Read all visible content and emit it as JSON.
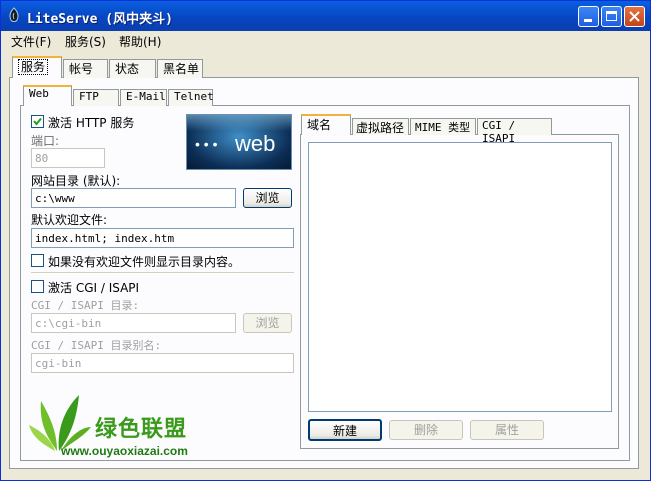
{
  "window": {
    "title": "LiteServe (风中夹斗)"
  },
  "menu": [
    {
      "label": "文件(F)"
    },
    {
      "label": "服务(S)"
    },
    {
      "label": "帮助(H)"
    }
  ],
  "top_tabs": [
    "服务",
    "帐号",
    "状态",
    "黑名单"
  ],
  "service_tabs": [
    "Web",
    "FTP",
    "E-Mail",
    "Telnet"
  ],
  "web": {
    "enable_http_label": "激活 HTTP 服务",
    "enable_http_checked": true,
    "banner_text": "web",
    "port_label": "端口:",
    "port_value": "80",
    "root_dir_label": "网站目录 (默认):",
    "root_dir_value": "c:\\www",
    "browse_label": "浏览",
    "default_doc_label": "默认欢迎文件:",
    "default_doc_value": "index.html; index.htm",
    "show_dir_label": "如果没有欢迎文件则显示目录内容。",
    "show_dir_checked": false,
    "enable_cgi_label": "激活 CGI / ISAPI",
    "enable_cgi_checked": false,
    "cgi_dir_label": "CGI / ISAPI 目录:",
    "cgi_dir_value": "c:\\cgi-bin",
    "cgi_browse_label": "浏览",
    "cgi_alias_label": "CGI / ISAPI 目录别名:",
    "cgi_alias_value": "cgi-bin"
  },
  "right_tabs": [
    "域名",
    "虚拟路径",
    "MIME 类型",
    "CGI / ISAPI"
  ],
  "right_buttons": {
    "new": "新建",
    "delete": "删除",
    "properties": "属性"
  },
  "watermark": {
    "brand": "绿色联盟",
    "url": "www.ouyaoxiazai.com"
  },
  "colors": {
    "titlebar": "#0746c2",
    "tab_highlight": "#f1b33c",
    "watermark_green": "#3a9a1a"
  }
}
